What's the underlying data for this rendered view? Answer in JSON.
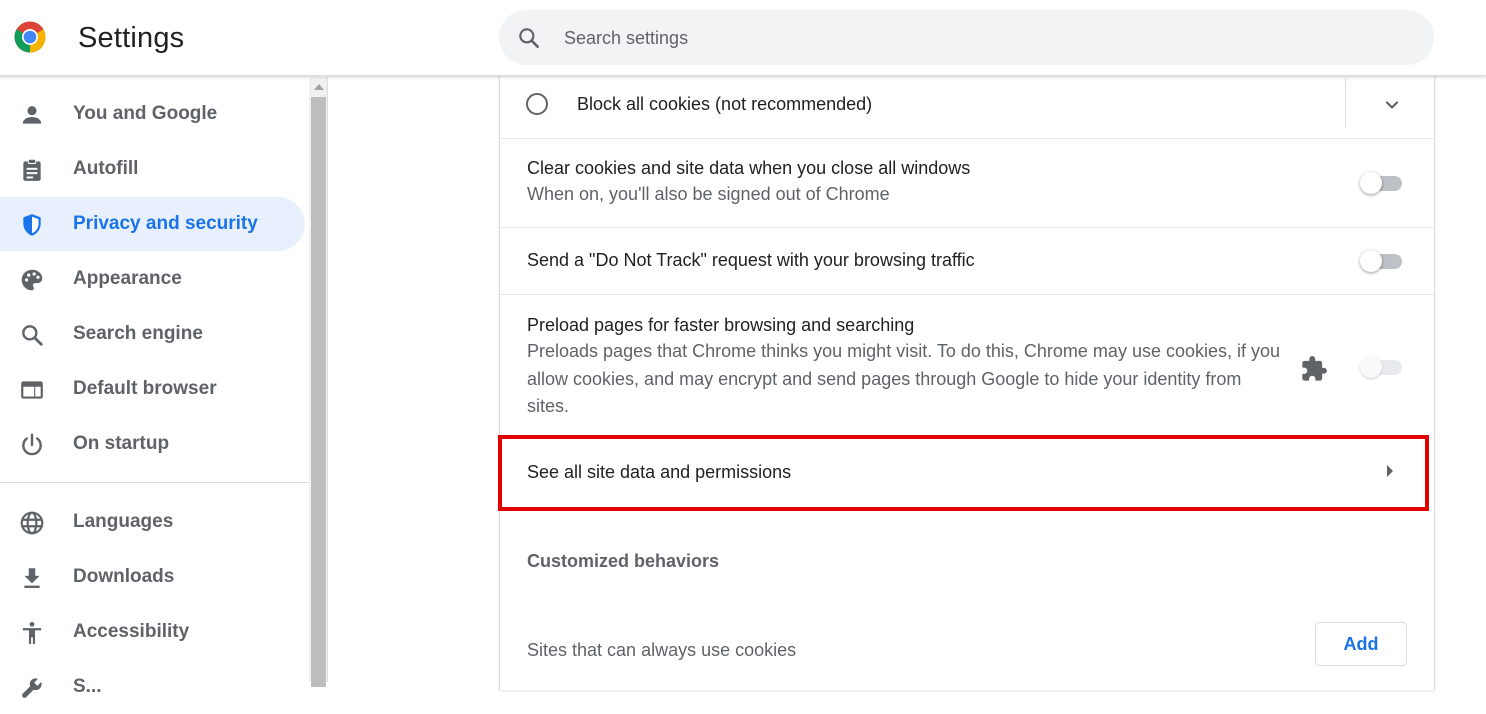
{
  "header": {
    "title": "Settings",
    "logo_icon": "chrome-logo",
    "search": {
      "placeholder": "Search settings",
      "value": "",
      "icon": "search-icon"
    }
  },
  "sidebar": {
    "items": [
      {
        "label": "You and Google",
        "icon": "person-icon",
        "selected": false
      },
      {
        "label": "Autofill",
        "icon": "clipboard-icon",
        "selected": false
      },
      {
        "label": "Privacy and security",
        "icon": "shield-icon",
        "selected": true
      },
      {
        "label": "Appearance",
        "icon": "palette-icon",
        "selected": false
      },
      {
        "label": "Search engine",
        "icon": "search-icon",
        "selected": false
      },
      {
        "label": "Default browser",
        "icon": "browser-window-icon",
        "selected": false
      },
      {
        "label": "On startup",
        "icon": "power-icon",
        "selected": false
      },
      {
        "label": "Languages",
        "icon": "globe-icon",
        "selected": false
      },
      {
        "label": "Downloads",
        "icon": "download-icon",
        "selected": false
      },
      {
        "label": "Accessibility",
        "icon": "accessibility-icon",
        "selected": false
      },
      {
        "label": "S...",
        "icon": "wrench-icon",
        "selected": false
      }
    ]
  },
  "main": {
    "rows": {
      "block_all": {
        "label": "Block all cookies (not recommended)",
        "selected": false
      },
      "clear_on_close": {
        "title": "Clear cookies and site data when you close all windows",
        "subtitle": "When on, you'll also be signed out of Chrome",
        "enabled": false
      },
      "do_not_track": {
        "title": "Send a \"Do Not Track\" request with your browsing traffic",
        "enabled": false
      },
      "preload": {
        "title": "Preload pages for faster browsing and searching",
        "subtitle": "Preloads pages that Chrome thinks you might visit. To do this, Chrome may use cookies, if you allow cookies, and may encrypt and send pages through Google to hide your identity from sites.",
        "enabled": false,
        "controlled_by_extension": true
      },
      "site_data": {
        "title": "See all site data and permissions"
      }
    },
    "customized": {
      "heading": "Customized behaviors",
      "always_allow_label": "Sites that can always use cookies",
      "add_button_label": "Add"
    }
  },
  "colors": {
    "accent": "#1a73e8",
    "selected_nav_bg": "#e8f0fe",
    "highlight_border": "#e00000",
    "secondary_text": "#5f6368"
  }
}
